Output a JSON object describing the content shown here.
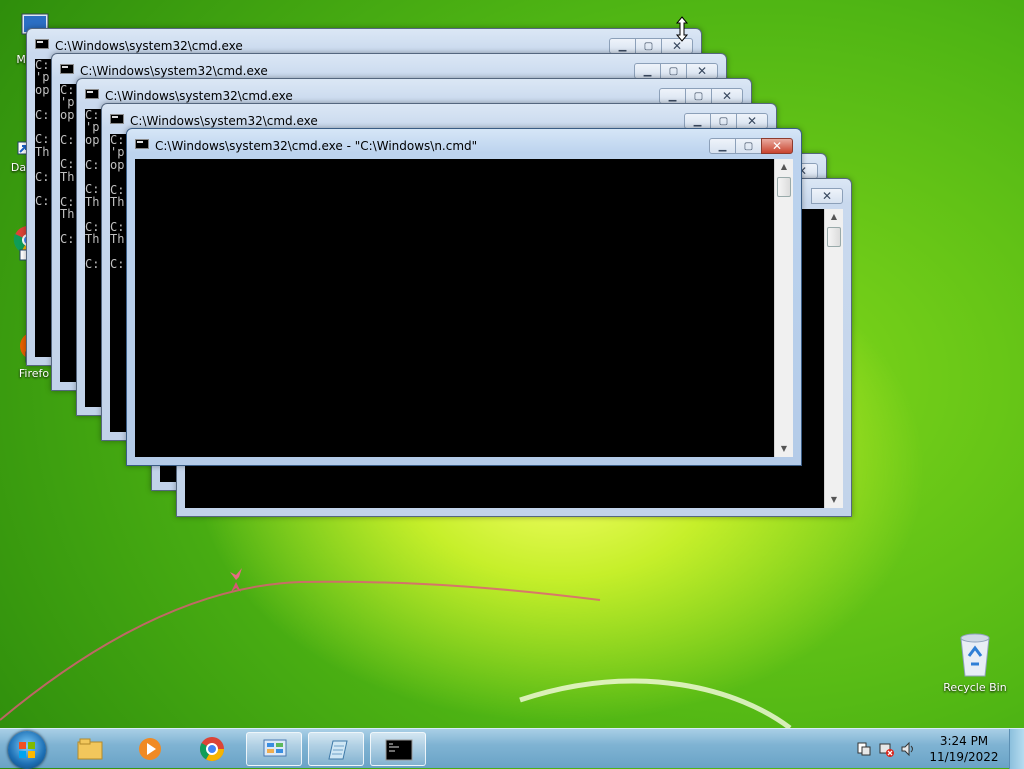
{
  "desktop": {
    "icons": [
      {
        "label": "My C",
        "icon": "computer-icon"
      },
      {
        "label": "Data",
        "icon": "shortcut-icon"
      },
      {
        "label": "",
        "icon": "chrome-shortcut-icon"
      },
      {
        "label": "Firefo",
        "icon": "firefox-icon"
      },
      {
        "label": "Recycle Bin",
        "icon": "recycle-bin-icon"
      }
    ]
  },
  "windows": [
    {
      "title": "C:\\Windows\\system32\\cmd.exe",
      "console": "C:\n'p\nop\n\nC:\n\nC:\nTh\n\nC:\n\nC:"
    },
    {
      "title": "C:\\Windows\\system32\\cmd.exe",
      "console": "C:\n'p\nop\n\nC:\n\nC:\nTh\n\nC:\nTh\n\nC:"
    },
    {
      "title": "C:\\Windows\\system32\\cmd.exe",
      "console": "C:\n'p\nop\n\nC:\n\nC:\nTh\n\nC:\nTh\n\nC:"
    },
    {
      "title": "C:\\Windows\\system32\\cmd.exe",
      "console": "C:\n'p\nop\n\nC:\nTh\n\nC:\nTh\n\nC:"
    },
    {
      "title": "",
      "console": ""
    },
    {
      "title": "",
      "console": ""
    },
    {
      "title": "C:\\Windows\\system32\\cmd.exe - \"C:\\Windows\\n.cmd\"",
      "console": ""
    }
  ],
  "taskbar": {
    "pinned": [
      "explorer-icon",
      "media-player-icon",
      "chrome-icon",
      "control-panel-icon",
      "notepad-icon",
      "cmd-icon"
    ],
    "clock_time": "3:24 PM",
    "clock_date": "11/19/2022"
  },
  "colors": {
    "desktop_green": "#5cbd16",
    "titlebar": "#c9d9ee",
    "close_red": "#c9442f"
  }
}
